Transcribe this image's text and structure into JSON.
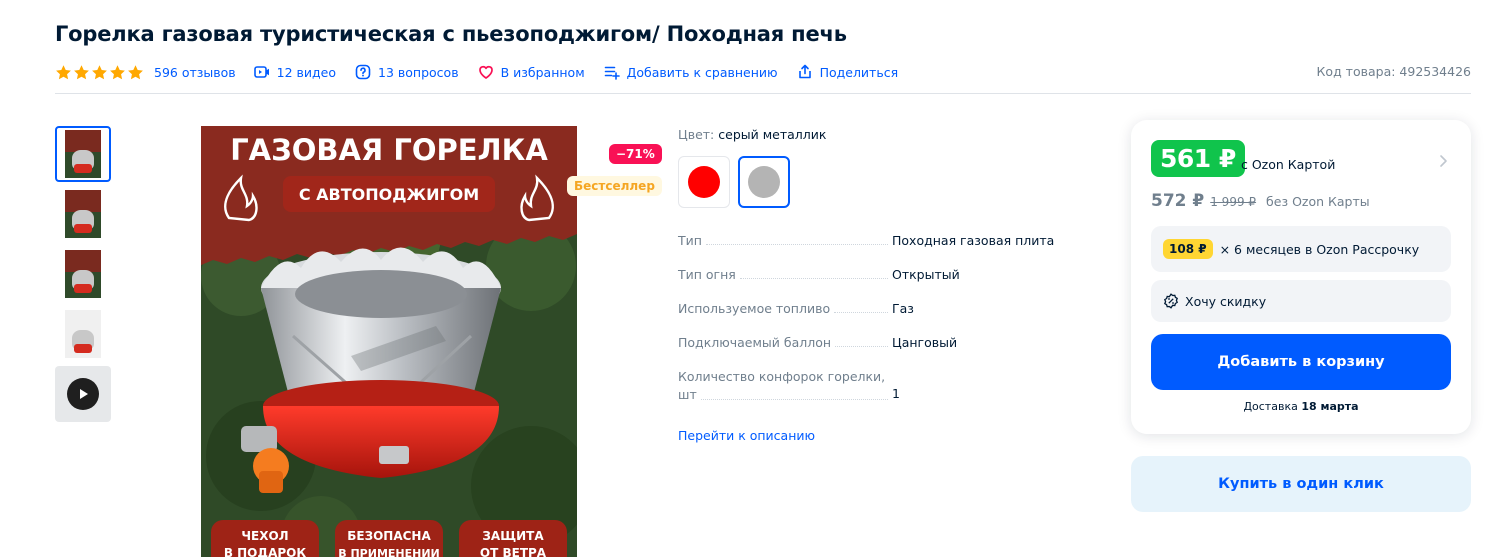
{
  "product": {
    "title": "Горелка газовая туристическая с пьезоподжигом/ Походная печь",
    "rating": 5,
    "reviews": "596 отзывов",
    "videos": "12 видео",
    "questions": "13 вопросов",
    "favorite": "В избранном",
    "compare": "Добавить к сравнению",
    "share": "Поделиться",
    "sku": "Код товара: 492534426"
  },
  "gallery": {
    "thumbnails": [
      "thumb-1",
      "thumb-2",
      "thumb-3",
      "thumb-4",
      "video"
    ],
    "main_image": {
      "headline": "ГАЗОВАЯ ГОРЕЛКА",
      "subheadline": "С АВТОПОДЖИГОМ",
      "tags": [
        [
          "ЧЕХОЛ",
          "В ПОДАРОК"
        ],
        [
          "БЕЗОПАСНА",
          "В ПРИМЕНЕНИИ"
        ],
        [
          "ЗАЩИТА",
          "ОТ ВЕТРА"
        ]
      ]
    },
    "badge_discount": "−71%",
    "badge_bestseller": "Бестселлер"
  },
  "specs": {
    "color_label": "Цвет:",
    "color_value": "серый металлик",
    "swatches": [
      {
        "name": "red",
        "color": "#ff0000"
      },
      {
        "name": "grey",
        "color": "#b4b4b4",
        "selected": true
      }
    ],
    "rows": [
      {
        "name": "Тип",
        "value": "Походная газовая плита"
      },
      {
        "name": "Тип огня",
        "value": "Открытый"
      },
      {
        "name": "Используемое топливо",
        "value": "Газ"
      },
      {
        "name": "Подключаемый баллон",
        "value": "Цанговый"
      }
    ],
    "multi_row": {
      "line1": "Количество конфорок горелки,",
      "line2": "шт",
      "value": "1"
    },
    "to_description": "Перейти к описанию"
  },
  "price": {
    "ozon_price": "561 ₽",
    "ozon_card_label": "с Ozon Картой",
    "regular_price": "572 ₽",
    "old_price": "1 999 ₽",
    "without_card_label": "без Ozon Карты",
    "installment_badge": "108 ₽",
    "installment_text": "× 6 месяцев в Ozon Рассрочку",
    "want_discount": "Хочу скидку",
    "add_to_cart": "Добавить в корзину",
    "delivery_label": "Доставка",
    "delivery_date": "18 марта",
    "buy_one_click": "Купить в один клик"
  },
  "colors": {
    "accent": "#005bff",
    "ozon_green": "#10c44c",
    "discount_pink": "#f91155",
    "star": "#ffa800"
  }
}
